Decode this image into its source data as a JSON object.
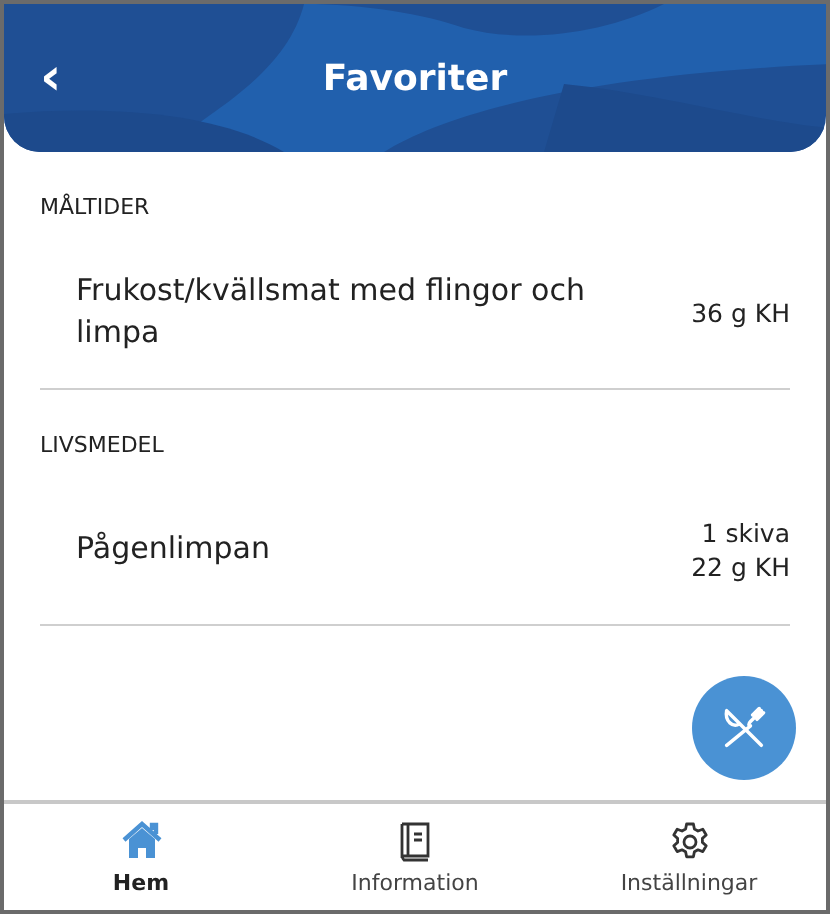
{
  "header": {
    "title": "Favoriter",
    "back_icon": "‹"
  },
  "sections": [
    {
      "title": "MÅLTIDER",
      "items": [
        {
          "name": "Frukost/kvällsmat med flingor och limpa",
          "amounts": [
            "36 g KH"
          ]
        }
      ]
    },
    {
      "title": "LIVSMEDEL",
      "items": [
        {
          "name": "Pågenlimpan",
          "amounts": [
            "1 skiva",
            "22 g KH"
          ]
        }
      ]
    }
  ],
  "tabs": [
    {
      "label": "Hem",
      "kind": "home",
      "selected": true
    },
    {
      "label": "Information",
      "kind": "book",
      "selected": false
    },
    {
      "label": "Inställningar",
      "kind": "gear",
      "selected": false
    }
  ]
}
